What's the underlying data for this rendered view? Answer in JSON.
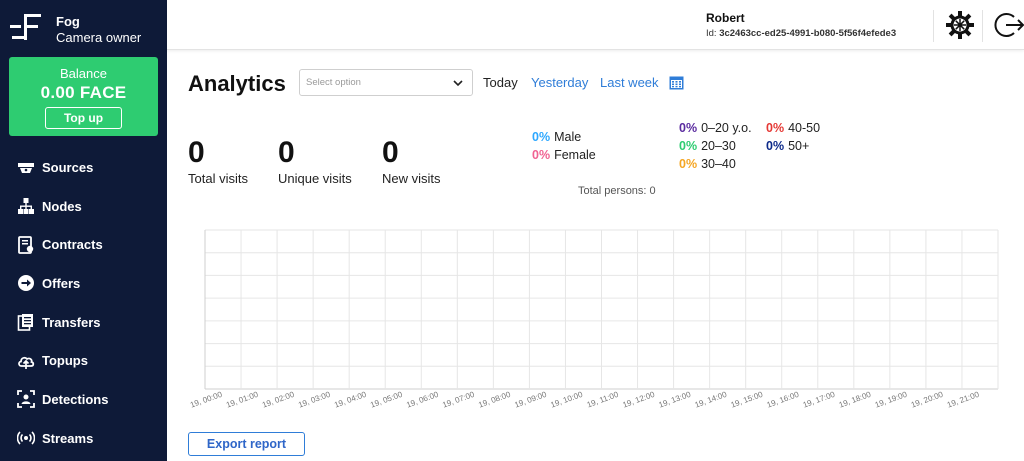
{
  "brand": {
    "name": "Fog",
    "role": "Camera owner",
    "logo_icon": "fog-logo-icon"
  },
  "balance": {
    "label": "Balance",
    "value": "0.00 FACE",
    "topup_label": "Top up",
    "color": "#2ecc71"
  },
  "sidebar": {
    "background": "#0e1a38",
    "items": [
      {
        "label": "Sources",
        "icon": "router-icon"
      },
      {
        "label": "Nodes",
        "icon": "hierarchy-icon"
      },
      {
        "label": "Contracts",
        "icon": "contract-icon"
      },
      {
        "label": "Offers",
        "icon": "arrow-circle-icon"
      },
      {
        "label": "Transfers",
        "icon": "documents-icon"
      },
      {
        "label": "Topups",
        "icon": "cloud-upload-icon"
      },
      {
        "label": "Detections",
        "icon": "face-scan-icon"
      },
      {
        "label": "Streams",
        "icon": "broadcast-icon"
      }
    ]
  },
  "header": {
    "user_name": "Robert",
    "user_id_label": "Id:",
    "user_id": "3c2463cc-ed25-4991-b080-5f56f4efede3",
    "settings_icon": "gear-icon",
    "logout_icon": "logout-icon"
  },
  "analytics": {
    "title": "Analytics",
    "select_placeholder": "Select option",
    "periods": {
      "today": "Today",
      "yesterday": "Yesterday",
      "last_week": "Last week"
    },
    "calendar_icon": "calendar-icon",
    "link_color": "#2f7dd8"
  },
  "stats": {
    "total_visits": {
      "value": "0",
      "label": "Total visits"
    },
    "unique_visits": {
      "value": "0",
      "label": "Unique visits"
    },
    "new_visits": {
      "value": "0",
      "label": "New visits"
    }
  },
  "gender": [
    {
      "pct": "0%",
      "label": "Male",
      "color": "#2ea8ff"
    },
    {
      "pct": "0%",
      "label": "Female",
      "color": "#f06292"
    }
  ],
  "age_groups": [
    {
      "pct": "0%",
      "label": "0–20 y.o.",
      "color": "#5b2ca0"
    },
    {
      "pct": "0%",
      "label": "20–30",
      "color": "#2ecc71"
    },
    {
      "pct": "0%",
      "label": "30–40",
      "color": "#f5a623"
    },
    {
      "pct": "0%",
      "label": "40-50",
      "color": "#e53935"
    },
    {
      "pct": "0%",
      "label": "50+",
      "color": "#0d2a8a"
    }
  ],
  "total_persons": "Total persons: 0",
  "chart_data": {
    "type": "line",
    "categories": [
      "19, 00:00",
      "19, 01:00",
      "19, 02:00",
      "19, 03:00",
      "19, 04:00",
      "19, 05:00",
      "19, 06:00",
      "19, 07:00",
      "19, 08:00",
      "19, 09:00",
      "19, 10:00",
      "19, 11:00",
      "19, 12:00",
      "19, 13:00",
      "19, 14:00",
      "19, 15:00",
      "19, 16:00",
      "19, 17:00",
      "19, 18:00",
      "19, 19:00",
      "19, 20:00",
      "19, 21:00"
    ],
    "series": [],
    "grid": true,
    "title": "",
    "xlabel": "",
    "ylabel": ""
  },
  "export_label": "Export report"
}
